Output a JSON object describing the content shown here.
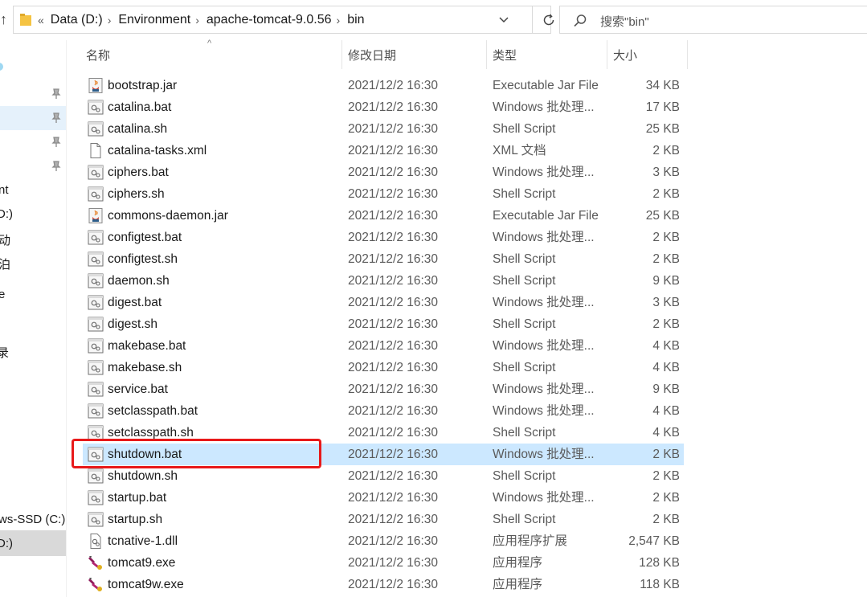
{
  "address_bar": {
    "overflow": "«",
    "path": [
      "Data (D:)",
      "Environment",
      "apache-tomcat-9.0.56",
      "bin"
    ]
  },
  "search": {
    "placeholder": "搜索\"bin\""
  },
  "nav_pane": {
    "fragments": [
      "nt",
      "D:)",
      "动",
      "泊",
      "e",
      "录",
      "ws-SSD (C:)",
      "D:)"
    ]
  },
  "columns": {
    "name": "名称",
    "date": "修改日期",
    "type": "类型",
    "size": "大小"
  },
  "files": [
    {
      "name": "bootstrap.jar",
      "date": "2021/12/2 16:30",
      "type": "Executable Jar File",
      "size": "34 KB",
      "icon": "jar"
    },
    {
      "name": "catalina.bat",
      "date": "2021/12/2 16:30",
      "type": "Windows 批处理...",
      "size": "17 KB",
      "icon": "script"
    },
    {
      "name": "catalina.sh",
      "date": "2021/12/2 16:30",
      "type": "Shell Script",
      "size": "25 KB",
      "icon": "script"
    },
    {
      "name": "catalina-tasks.xml",
      "date": "2021/12/2 16:30",
      "type": "XML 文档",
      "size": "2 KB",
      "icon": "doc"
    },
    {
      "name": "ciphers.bat",
      "date": "2021/12/2 16:30",
      "type": "Windows 批处理...",
      "size": "3 KB",
      "icon": "script"
    },
    {
      "name": "ciphers.sh",
      "date": "2021/12/2 16:30",
      "type": "Shell Script",
      "size": "2 KB",
      "icon": "script"
    },
    {
      "name": "commons-daemon.jar",
      "date": "2021/12/2 16:30",
      "type": "Executable Jar File",
      "size": "25 KB",
      "icon": "jar"
    },
    {
      "name": "configtest.bat",
      "date": "2021/12/2 16:30",
      "type": "Windows 批处理...",
      "size": "2 KB",
      "icon": "script"
    },
    {
      "name": "configtest.sh",
      "date": "2021/12/2 16:30",
      "type": "Shell Script",
      "size": "2 KB",
      "icon": "script"
    },
    {
      "name": "daemon.sh",
      "date": "2021/12/2 16:30",
      "type": "Shell Script",
      "size": "9 KB",
      "icon": "script"
    },
    {
      "name": "digest.bat",
      "date": "2021/12/2 16:30",
      "type": "Windows 批处理...",
      "size": "3 KB",
      "icon": "script"
    },
    {
      "name": "digest.sh",
      "date": "2021/12/2 16:30",
      "type": "Shell Script",
      "size": "2 KB",
      "icon": "script"
    },
    {
      "name": "makebase.bat",
      "date": "2021/12/2 16:30",
      "type": "Windows 批处理...",
      "size": "4 KB",
      "icon": "script"
    },
    {
      "name": "makebase.sh",
      "date": "2021/12/2 16:30",
      "type": "Shell Script",
      "size": "4 KB",
      "icon": "script"
    },
    {
      "name": "service.bat",
      "date": "2021/12/2 16:30",
      "type": "Windows 批处理...",
      "size": "9 KB",
      "icon": "script"
    },
    {
      "name": "setclasspath.bat",
      "date": "2021/12/2 16:30",
      "type": "Windows 批处理...",
      "size": "4 KB",
      "icon": "script"
    },
    {
      "name": "setclasspath.sh",
      "date": "2021/12/2 16:30",
      "type": "Shell Script",
      "size": "4 KB",
      "icon": "script"
    },
    {
      "name": "shutdown.bat",
      "date": "2021/12/2 16:30",
      "type": "Windows 批处理...",
      "size": "2 KB",
      "icon": "script",
      "selected": true
    },
    {
      "name": "shutdown.sh",
      "date": "2021/12/2 16:30",
      "type": "Shell Script",
      "size": "2 KB",
      "icon": "script"
    },
    {
      "name": "startup.bat",
      "date": "2021/12/2 16:30",
      "type": "Windows 批处理...",
      "size": "2 KB",
      "icon": "script"
    },
    {
      "name": "startup.sh",
      "date": "2021/12/2 16:30",
      "type": "Shell Script",
      "size": "2 KB",
      "icon": "script"
    },
    {
      "name": "tcnative-1.dll",
      "date": "2021/12/2 16:30",
      "type": "应用程序扩展",
      "size": "2,547 KB",
      "icon": "dll"
    },
    {
      "name": "tomcat9.exe",
      "date": "2021/12/2 16:30",
      "type": "应用程序",
      "size": "128 KB",
      "icon": "exe"
    },
    {
      "name": "tomcat9w.exe",
      "date": "2021/12/2 16:30",
      "type": "应用程序",
      "size": "118 KB",
      "icon": "exe"
    }
  ],
  "colors": {
    "selection": "#cce8ff",
    "highlight_border": "#e8191a",
    "nav_selection": "#e5f1fb"
  }
}
